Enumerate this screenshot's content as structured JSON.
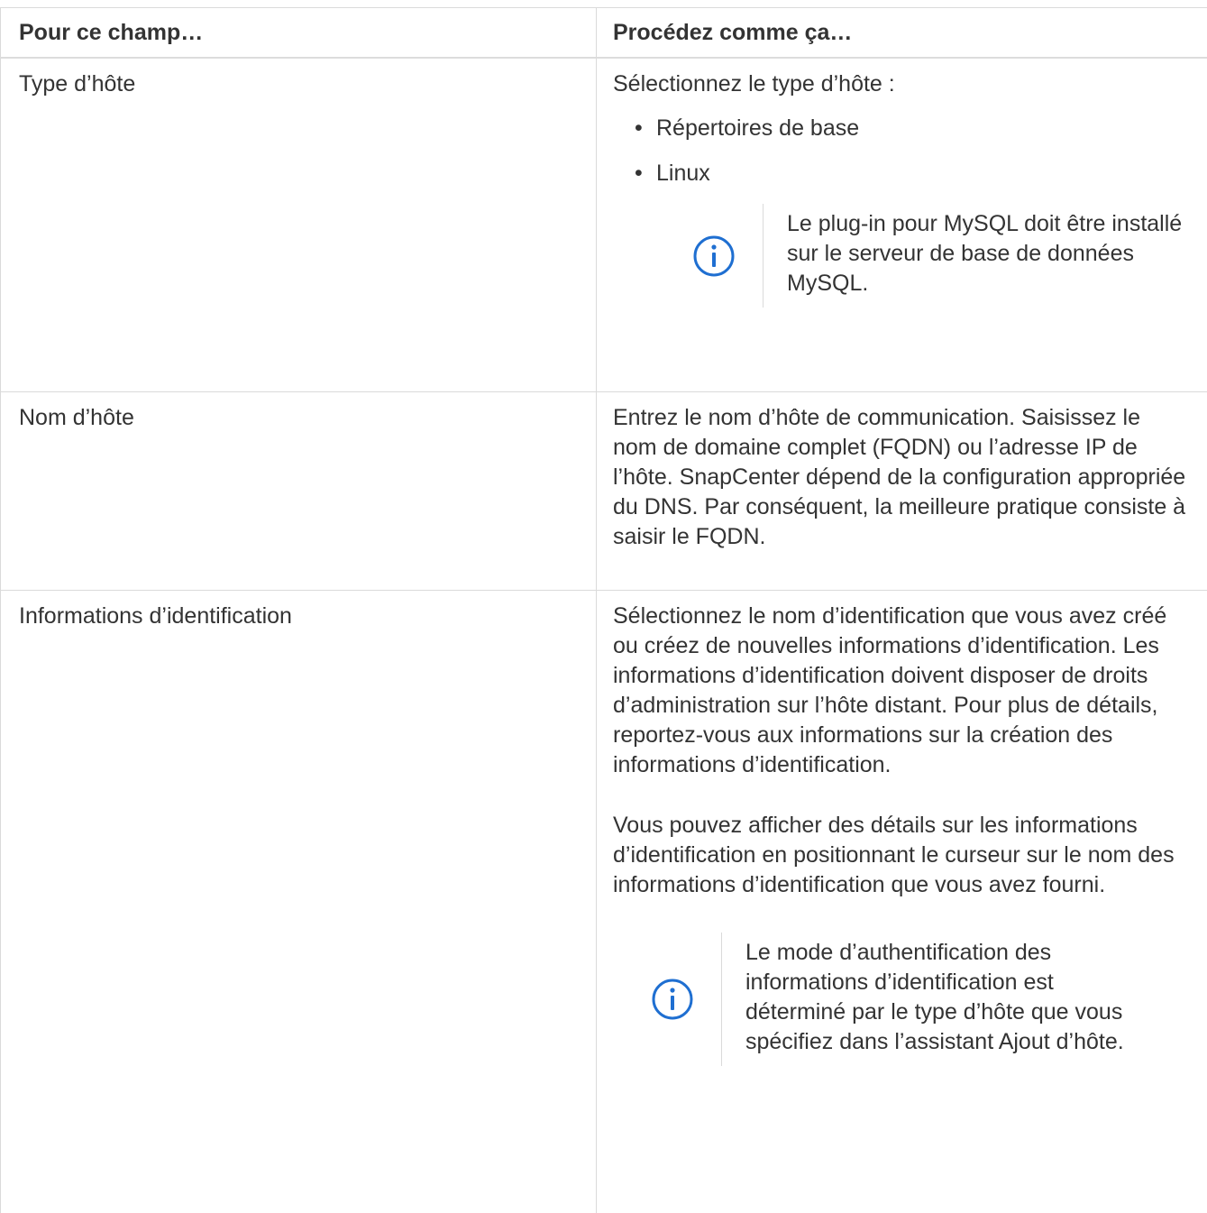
{
  "table": {
    "header": {
      "col1": "Pour ce champ…",
      "col2": "Procédez comme ça…"
    },
    "rows": [
      {
        "field": "Type d’hôte",
        "intro": "Sélectionnez le type d’hôte :",
        "options": [
          "Répertoires de base",
          "Linux"
        ],
        "note": "Le plug-in pour MySQL doit être installé sur le serveur de base de données MySQL."
      },
      {
        "field": "Nom d’hôte",
        "text": "Entrez le nom d’hôte de communication. Saisissez le nom de domaine complet (FQDN) ou l’adresse IP de l’hôte. SnapCenter dépend de la configuration appropriée du DNS. Par conséquent, la meilleure pratique consiste à saisir le FQDN."
      },
      {
        "field": "Informations d’identification",
        "text1": "Sélectionnez le nom d’identification que vous avez créé ou créez de nouvelles informations d’identification. Les informations d’identification doivent disposer de droits d’administration sur l’hôte distant. Pour plus de détails, reportez-vous aux informations sur la création des informations d’identification.",
        "text2": "Vous pouvez afficher des détails sur les informations d’identification en positionnant le curseur sur le nom des informations d’identification que vous avez fourni.",
        "note": "Le mode d’authentification des informations d’identification est déterminé par le type d’hôte que vous spécifiez dans l’assistant Ajout d’hôte."
      }
    ]
  },
  "bullet_char": "•",
  "colors": {
    "text": "#333333",
    "border": "#dadada",
    "info_icon": "#1f6fd1"
  },
  "icons": {
    "note": "info-icon"
  }
}
